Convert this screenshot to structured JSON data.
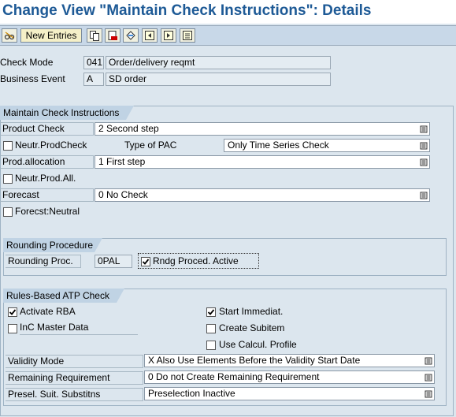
{
  "window": {
    "title": "Change View \"Maintain Check Instructions\": Details"
  },
  "toolbar": {
    "new_entries_label": "New Entries"
  },
  "header": {
    "check_mode_label": "Check Mode",
    "check_mode_code": "041",
    "check_mode_text": "Order/delivery reqmt",
    "business_event_label": "Business Event",
    "business_event_code": "A",
    "business_event_text": "SD order"
  },
  "check_instructions": {
    "group_title": "Maintain Check Instructions",
    "product_check_label": "Product Check",
    "product_check_value": "2 Second step",
    "neutr_prod_check_label": "Neutr.ProdCheck",
    "neutr_prod_check_checked": false,
    "type_of_pac_label": "Type of PAC",
    "type_of_pac_value": "Only Time Series Check",
    "prod_allocation_label": "Prod.allocation",
    "prod_allocation_value": "1 First step",
    "neutr_prod_all_label": "Neutr.Prod.All.",
    "neutr_prod_all_checked": false,
    "forecast_label": "Forecast",
    "forecast_value": "0 No Check",
    "forecst_neutral_label": "Forecst:Neutral",
    "forecst_neutral_checked": false
  },
  "rounding": {
    "group_title": "Rounding Procedure",
    "rounding_proc_label": "Rounding Proc.",
    "rounding_proc_value": "0PAL",
    "rndg_active_label": "Rndg Proced. Active",
    "rndg_active_checked": true
  },
  "rba": {
    "group_title": "Rules-Based ATP Check",
    "activate_rba_label": "Activate RBA",
    "activate_rba_checked": true,
    "start_immediat_label": "Start Immediat.",
    "start_immediat_checked": true,
    "inc_master_data_label": "InC Master Data",
    "inc_master_data_checked": false,
    "create_subitem_label": "Create Subitem",
    "create_subitem_checked": false,
    "use_calcul_profile_label": "Use Calcul. Profile",
    "use_calcul_profile_checked": false,
    "validity_mode_label": "Validity Mode",
    "validity_mode_value": "X Also Use Elements Before the Validity Start Date",
    "remaining_req_label": "Remaining Requirement",
    "remaining_req_value": "0 Do not Create Remaining Requirement",
    "presel_label": "Presel. Suit. Substitns",
    "presel_value": "Preselection Inactive"
  },
  "colors": {
    "title": "#1e5a96",
    "background": "#dce6ee",
    "group_header": "#c0d3e4"
  },
  "icons": [
    "edit-glasses-icon",
    "copy-icon",
    "delete-icon",
    "undo-icon",
    "previous-entry-icon",
    "next-entry-icon",
    "select-all-icon",
    "dropdown-icon",
    "checkmark-icon"
  ]
}
